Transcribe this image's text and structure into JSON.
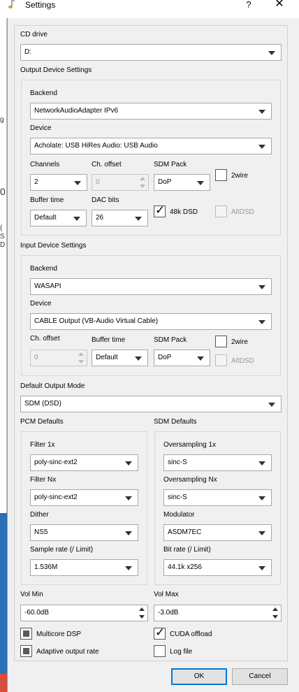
{
  "window": {
    "title": "Settings",
    "help_label": "?",
    "close_label": "✕"
  },
  "background_fragments": [
    "g",
    "0",
    "(",
    "S",
    "D"
  ],
  "cd_drive": {
    "label": "CD drive",
    "value": "D:"
  },
  "output": {
    "section_label": "Output Device Settings",
    "backend_label": "Backend",
    "backend_value": "NetworkAudioAdapter IPv6",
    "device_label": "Device",
    "device_value": "Acholate: USB HiRes Audio: USB Audio",
    "channels_label": "Channels",
    "channels_value": "2",
    "ch_offset_label": "Ch. offset",
    "ch_offset_value": "0",
    "sdm_pack_label": "SDM Pack",
    "sdm_pack_value": "DoP",
    "twowire_label": "2wire",
    "buffer_time_label": "Buffer time",
    "buffer_time_value": "Default",
    "dac_bits_label": "DAC bits",
    "dac_bits_value": "26",
    "dsd48k_label": "48k DSD",
    "altdsd_label": "AltDSD"
  },
  "input": {
    "section_label": "Input Device Settings",
    "backend_label": "Backend",
    "backend_value": "WASAPI",
    "device_label": "Device",
    "device_value": "CABLE Output (VB-Audio Virtual Cable)",
    "ch_offset_label": "Ch. offset",
    "ch_offset_value": "0",
    "buffer_time_label": "Buffer time",
    "buffer_time_value": "Default",
    "sdm_pack_label": "SDM Pack",
    "sdm_pack_value": "DoP",
    "twowire_label": "2wire",
    "altdsd_label": "AltDSD"
  },
  "default_output_mode": {
    "label": "Default Output Mode",
    "value": "SDM (DSD)"
  },
  "pcm": {
    "section_label": "PCM Defaults",
    "filter1x_label": "Filter 1x",
    "filter1x_value": "poly-sinc-ext2",
    "filternx_label": "Filter Nx",
    "filternx_value": "poly-sinc-ext2",
    "dither_label": "Dither",
    "dither_value": "NS5",
    "sample_rate_label": "Sample rate (/ Limit)",
    "sample_rate_value": "1.536M"
  },
  "sdm": {
    "section_label": "SDM Defaults",
    "os1x_label": "Oversampling 1x",
    "os1x_value": "sinc-S",
    "osnx_label": "Oversampling Nx",
    "osnx_value": "sinc-S",
    "modulator_label": "Modulator",
    "modulator_value": "ASDM7EC",
    "bit_rate_label": "Bit rate (/ Limit)",
    "bit_rate_value": "44.1k x256"
  },
  "volume": {
    "min_label": "Vol Min",
    "min_value": "-60.0dB",
    "max_label": "Vol Max",
    "max_value": "-3.0dB"
  },
  "options": {
    "multicore_label": "Multicore DSP",
    "cuda_label": "CUDA offload",
    "adaptive_label": "Adaptive output rate",
    "logfile_label": "Log file"
  },
  "buttons": {
    "ok_label": "OK",
    "cancel_label": "Cancel"
  }
}
